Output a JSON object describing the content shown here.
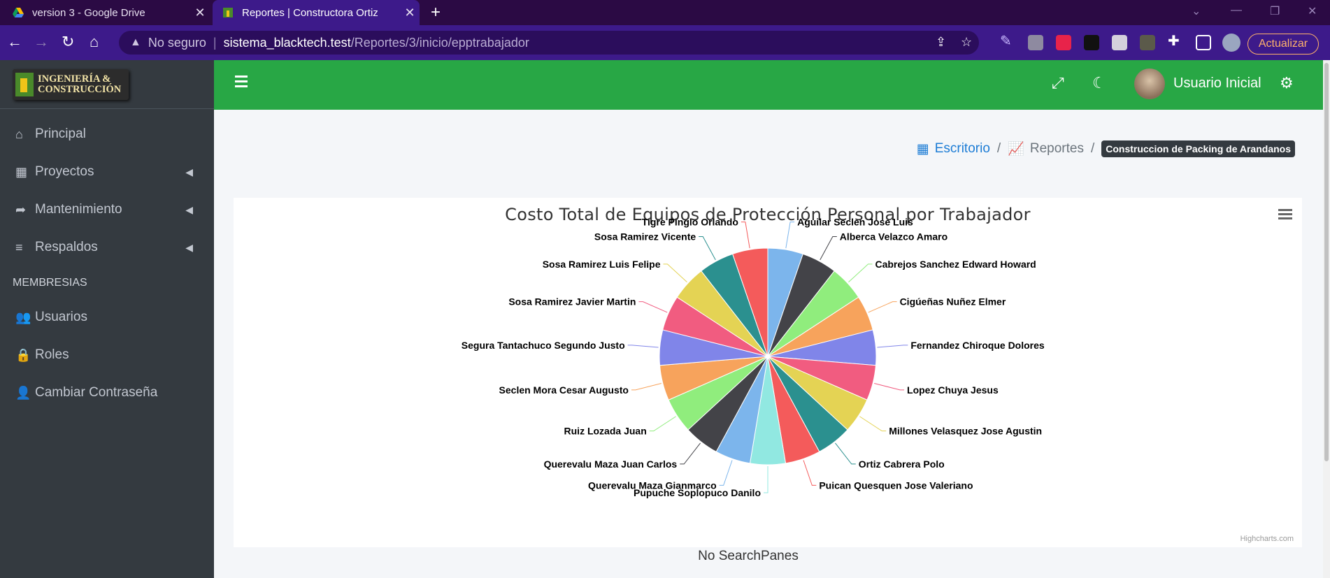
{
  "browser": {
    "tabs": [
      {
        "title": "version 3 - Google Drive",
        "active": false
      },
      {
        "title": "Reportes | Constructora Ortiz",
        "active": true
      }
    ],
    "omnibox": {
      "security": "No seguro",
      "host": "sistema_blacktech.test",
      "path": "/Reportes/3/inicio/epptrabajador"
    },
    "update_label": "Actualizar"
  },
  "sidebar": {
    "brand": {
      "line1": "INGENIERÍA &",
      "line2": "CONSTRUCCIÓN"
    },
    "items": [
      {
        "label": "Principal",
        "icon": "home-icon"
      },
      {
        "label": "Proyectos",
        "icon": "cubes-icon"
      },
      {
        "label": "Mantenimiento",
        "icon": "share-icon"
      },
      {
        "label": "Respaldos",
        "icon": "database-icon"
      }
    ],
    "header": "MEMBRESIAS",
    "items2": [
      {
        "label": "Usuarios",
        "icon": "users-icon"
      },
      {
        "label": "Roles",
        "icon": "user-lock-icon"
      },
      {
        "label": "Cambiar Contraseña",
        "icon": "user-icon"
      }
    ]
  },
  "topnav": {
    "username": "Usuario Inicial"
  },
  "breadcrumb": {
    "home": "Escritorio",
    "reports": "Reportes",
    "current": "Construccion de Packing de Arandanos"
  },
  "chart_data": {
    "type": "pie",
    "title": "Costo Total de Equipos de Protección Personal por Trabajador",
    "series": [
      {
        "name": "Aguilar Seclen Jose Luis",
        "value": 1,
        "color": "#7cb5ec"
      },
      {
        "name": "Alberca Velazco Amaro",
        "value": 1,
        "color": "#434348"
      },
      {
        "name": "Cabrejos Sanchez Edward Howard",
        "value": 1,
        "color": "#90ed7d"
      },
      {
        "name": "Cigúeñas Nuñez Elmer",
        "value": 1,
        "color": "#f7a35c"
      },
      {
        "name": "Fernandez Chiroque Dolores",
        "value": 1,
        "color": "#8085e9"
      },
      {
        "name": "Lopez Chuya Jesus",
        "value": 1,
        "color": "#f15c80"
      },
      {
        "name": "Millones Velasquez Jose Agustin",
        "value": 1,
        "color": "#e4d354"
      },
      {
        "name": "Ortiz Cabrera Polo",
        "value": 1,
        "color": "#2b908f"
      },
      {
        "name": "Puican Quesquen Jose Valeriano",
        "value": 1,
        "color": "#f45b5b"
      },
      {
        "name": "Pupuche Soplopuco Danilo",
        "value": 1,
        "color": "#91e8e1"
      },
      {
        "name": "Querevalu Maza Gianmarco",
        "value": 1,
        "color": "#7cb5ec"
      },
      {
        "name": "Querevalu Maza Juan Carlos",
        "value": 1,
        "color": "#434348"
      },
      {
        "name": "Ruiz Lozada Juan",
        "value": 1,
        "color": "#90ed7d"
      },
      {
        "name": "Seclen Mora Cesar Augusto",
        "value": 1,
        "color": "#f7a35c"
      },
      {
        "name": "Segura Tantachuco Segundo Justo",
        "value": 1,
        "color": "#8085e9"
      },
      {
        "name": "Sosa Ramirez Javier Martin",
        "value": 1,
        "color": "#f15c80"
      },
      {
        "name": "Sosa Ramirez Luis Felipe",
        "value": 1,
        "color": "#e4d354"
      },
      {
        "name": "Sosa Ramirez Vicente",
        "value": 1,
        "color": "#2b908f"
      },
      {
        "name": "Tigre Pinglo Orlando",
        "value": 1,
        "color": "#f45b5b"
      }
    ],
    "credits": "Highcharts.com"
  },
  "footer_text": "No SearchPanes"
}
